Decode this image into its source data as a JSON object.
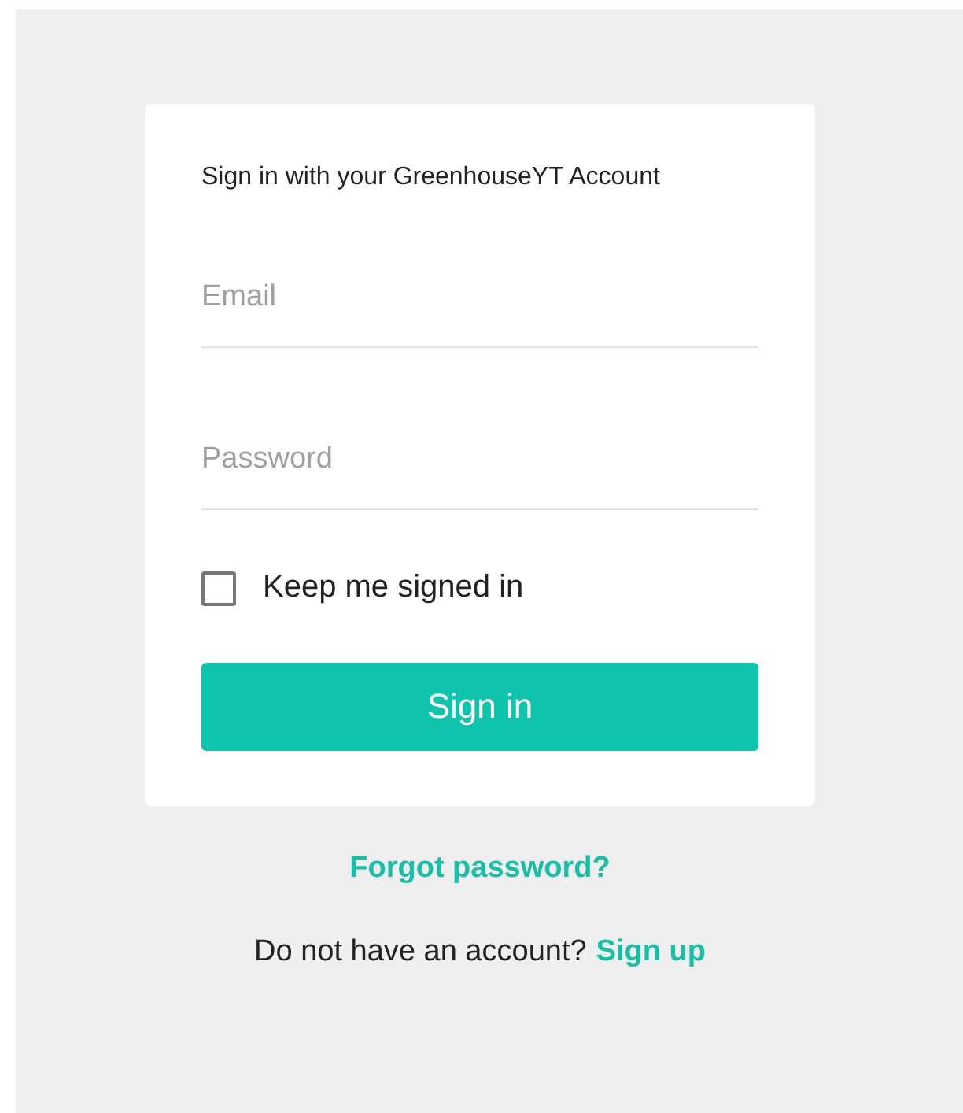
{
  "card": {
    "title": "Sign in with your GreenhouseYT Account",
    "fields": [
      {
        "placeholder": "Email"
      },
      {
        "placeholder": "Password"
      }
    ],
    "remember": {
      "label": "Keep me signed in",
      "checked": false
    },
    "submit": "Sign in"
  },
  "forgot_link": "Forgot password?",
  "signup": {
    "text": "Do not have an account?",
    "link": "Sign up"
  }
}
